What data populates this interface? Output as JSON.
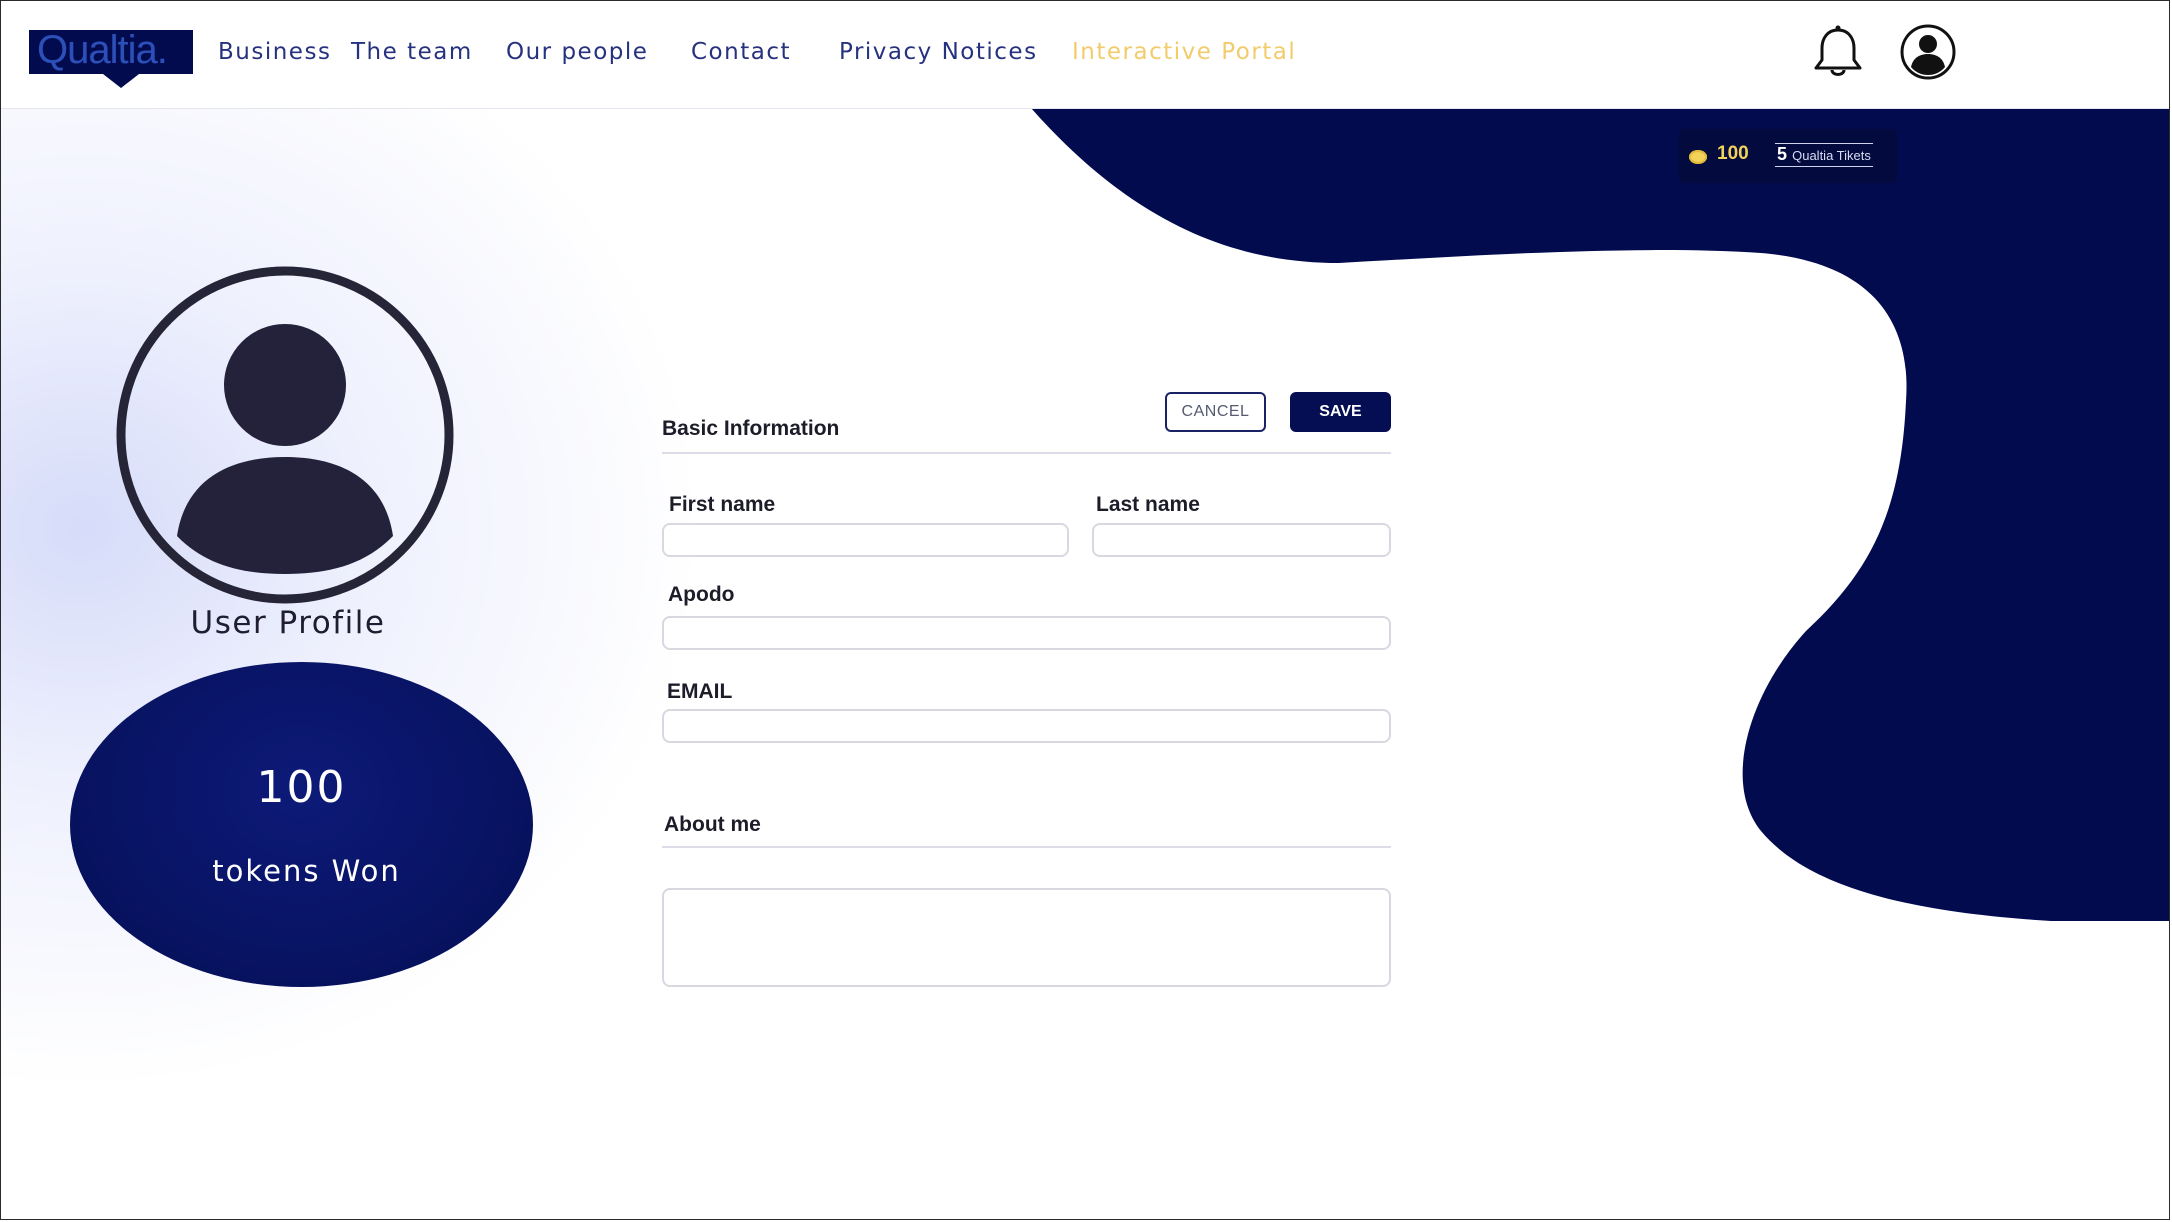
{
  "header": {
    "logo_text": "Qualtia.",
    "nav": [
      {
        "label": "Business"
      },
      {
        "label": "The team"
      },
      {
        "label": "Our people"
      },
      {
        "label": "Contact"
      },
      {
        "label": "Privacy Notices"
      },
      {
        "label": "Interactive Portal",
        "active": true
      }
    ]
  },
  "badge": {
    "tokens": "100",
    "tickets_count": "5",
    "tickets_label": "Qualtia Tikets"
  },
  "profile": {
    "title": "User Profile",
    "tokens_value": "100",
    "tokens_label": "tokens Won"
  },
  "form": {
    "section_title": "Basic Information",
    "cancel_label": "CANCEL",
    "save_label": "SAVE",
    "first_name_label": "First name",
    "first_name_value": "",
    "last_name_label": "Last name",
    "last_name_value": "",
    "apodo_label": "Apodo",
    "apodo_value": "",
    "email_label": "EMAIL",
    "email_value": "",
    "about_title": "About me",
    "about_value": ""
  },
  "colors": {
    "nav_text": "#26327e",
    "nav_active": "#f2cc6c",
    "brand_navy": "#050e52",
    "coin": "#f3d25a"
  },
  "icons": {
    "notifications": "bell-icon",
    "account": "user-circle-icon",
    "coin": "coin-icon"
  }
}
